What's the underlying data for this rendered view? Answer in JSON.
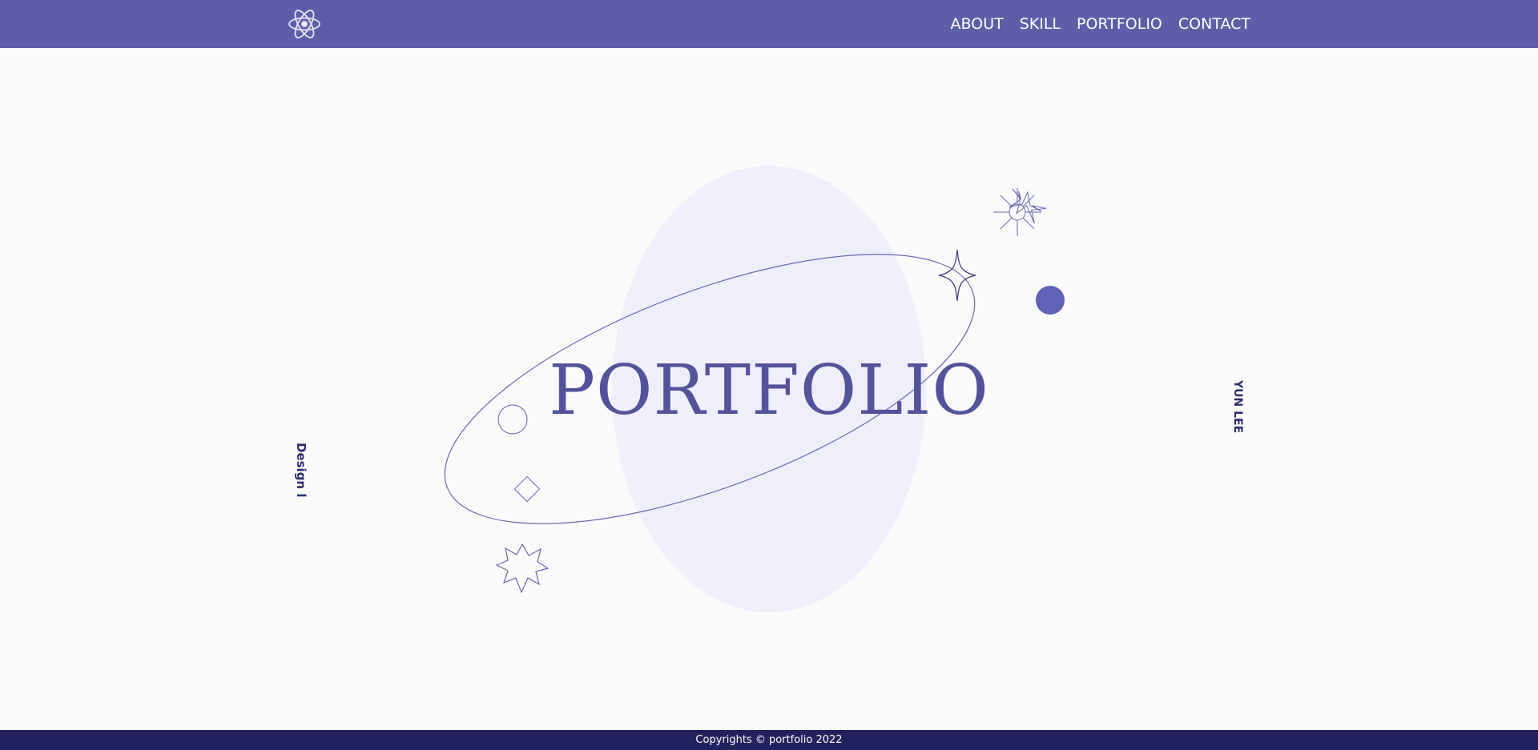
{
  "header": {
    "logo_icon": "atom-icon",
    "nav": [
      {
        "label": "ABOUT"
      },
      {
        "label": "SKILL"
      },
      {
        "label": "PORTFOLIO"
      },
      {
        "label": "CONTACT"
      }
    ]
  },
  "hero": {
    "title": "PORTFOLIO",
    "side_left": "Design l",
    "side_right": "YUN LEE"
  },
  "footer": {
    "copyright": "Copyrights © portfolio 2022"
  },
  "colors": {
    "header_bg": "#5e5da8",
    "footer_bg": "#22215e",
    "accent": "#5e5db8",
    "blob": "#efeffb",
    "title": "#53529b"
  }
}
